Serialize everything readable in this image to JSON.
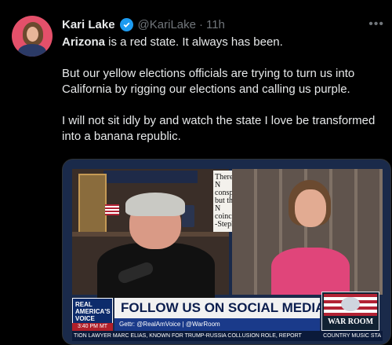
{
  "tweet": {
    "author_name": "Kari Lake",
    "handle": "@KariLake",
    "separator": "·",
    "time": "11h",
    "more_icon": "more-horizontal-icon",
    "verified_color": "#1d9bf0",
    "paragraphs": [
      {
        "bold": "Arizona",
        "rest": " is a red state. It always has been."
      },
      {
        "text": "But our yellow elections officials are trying to turn us into California by rigging our elections and calling us purple."
      },
      {
        "text": "I will not sit idly by and watch the state I love be transformed into a banana republic."
      }
    ]
  },
  "media": {
    "sign_lines": [
      "There",
      "N",
      "conspi",
      "but the",
      "N",
      "coinci",
      "-Steph"
    ],
    "logo_lines": [
      "REAL",
      "AMERICA'S",
      "VOICE"
    ],
    "time_chip": "3:40 PM MT",
    "banner": "FOLLOW US ON SOCIAL MEDIA",
    "handles": "Gettr: @RealAmVoice | @WarRoom",
    "warroom": "WAR ROOM",
    "ticker_left": "TION LAWYER MARC ELIAS, KNOWN FOR TRUMP-RUSSIA COLLUSION ROLE, REPORT",
    "ticker_right": "COUNTRY MUSIC STA"
  }
}
